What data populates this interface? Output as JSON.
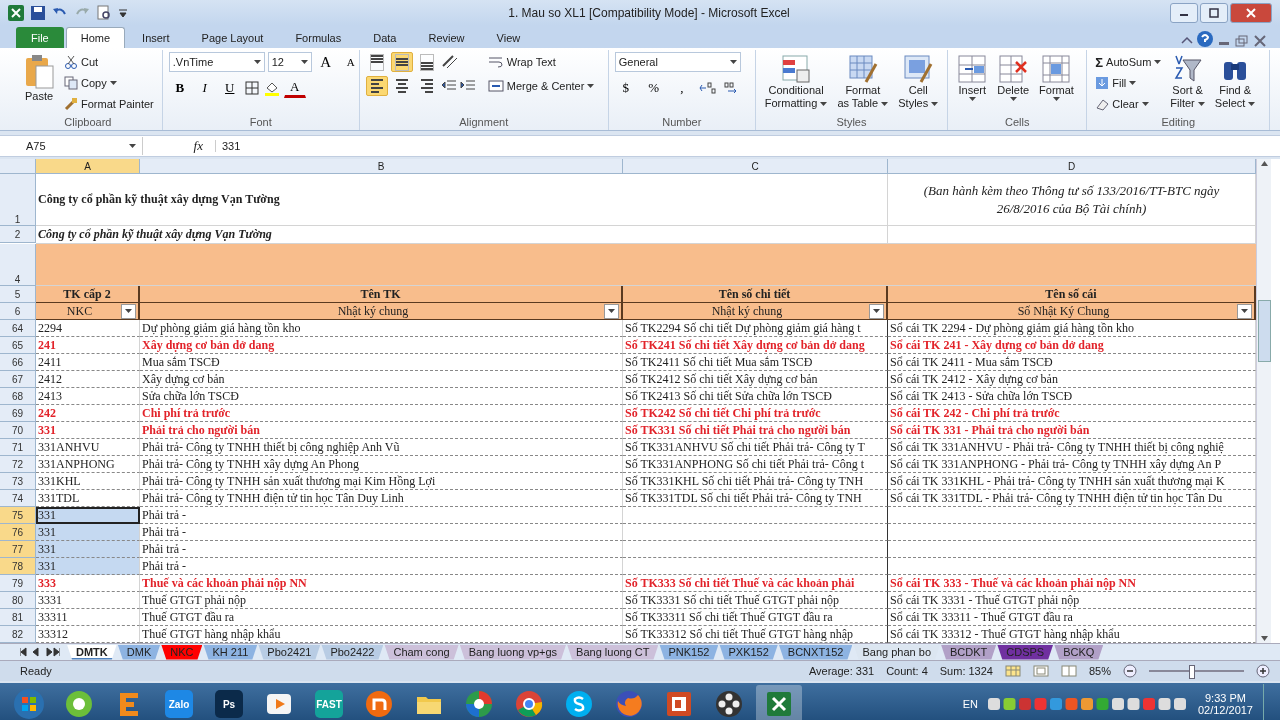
{
  "window": {
    "title": "1. Mau so XL1  [Compatibility Mode] - Microsoft Excel"
  },
  "ribbon_tabs": [
    {
      "label": "File",
      "kind": "file",
      "selected": false
    },
    {
      "label": "Home",
      "kind": "tab",
      "selected": true
    },
    {
      "label": "Insert",
      "kind": "tab",
      "selected": false
    },
    {
      "label": "Page Layout",
      "kind": "tab",
      "selected": false
    },
    {
      "label": "Formulas",
      "kind": "tab",
      "selected": false
    },
    {
      "label": "Data",
      "kind": "tab",
      "selected": false
    },
    {
      "label": "Review",
      "kind": "tab",
      "selected": false
    },
    {
      "label": "View",
      "kind": "tab",
      "selected": false
    }
  ],
  "clipboard": {
    "label": "Clipboard",
    "paste": "Paste",
    "cut": "Cut",
    "copy": "Copy",
    "format_painter": "Format Painter"
  },
  "font": {
    "label": "Font",
    "family": ".VnTime",
    "size": "12",
    "grow": "A",
    "shrink": "A",
    "styles": [
      "B",
      "I",
      "U"
    ],
    "font_color": "A"
  },
  "alignment": {
    "label": "Alignment",
    "wrap_text": "Wrap Text",
    "merge": "Merge & Center",
    "vertical": [
      {
        "kind": "top",
        "selected": false
      },
      {
        "kind": "middle",
        "selected": true
      },
      {
        "kind": "bottom",
        "selected": false
      }
    ],
    "horizontal": [
      {
        "kind": "left",
        "selected": true
      },
      {
        "kind": "center",
        "selected": false
      },
      {
        "kind": "right",
        "selected": false
      }
    ]
  },
  "number": {
    "label": "Number",
    "format": "General",
    "currency": "$",
    "percent": "%",
    "comma": ","
  },
  "styles": {
    "label": "Styles",
    "buttons": [
      {
        "kind": "conditional",
        "lines": [
          "Conditional",
          "Formatting"
        ]
      },
      {
        "kind": "table",
        "lines": [
          "Format",
          "as Table"
        ]
      },
      {
        "kind": "cellstyle",
        "lines": [
          "Cell",
          "Styles"
        ]
      }
    ]
  },
  "cells": {
    "label": "Cells",
    "buttons": [
      {
        "kind": "insert",
        "label": "Insert"
      },
      {
        "kind": "delete",
        "label": "Delete"
      },
      {
        "kind": "format",
        "label": "Format"
      }
    ]
  },
  "editing": {
    "label": "Editing",
    "sigma": "Σ",
    "autosum": "AutoSum",
    "fill": "Fill",
    "clear": "Clear",
    "sort": [
      "Sort &",
      "Filter"
    ],
    "find": [
      "Find &",
      "Select"
    ]
  },
  "formula_bar": {
    "name_box": "A75",
    "fx": "fx",
    "formula": "331"
  },
  "columns": [
    {
      "label": "A",
      "selected": true
    },
    {
      "label": "B",
      "selected": false
    },
    {
      "label": "C",
      "selected": false
    },
    {
      "label": "D",
      "selected": false
    }
  ],
  "title_rows": {
    "row1": {
      "number": "1",
      "company": "Công ty cổ phần kỹ thuật xây dựng Vạn Tường",
      "note": "(Ban hành kèm theo Thông tư số 133/2016/TT-BTC ngày 26/8/2016 của Bộ Tài chính)"
    },
    "row2": {
      "number": "2",
      "company": "Công ty cổ phần kỹ thuật xây dựng Vạn Tường"
    },
    "row4": {
      "number": "4"
    }
  },
  "header_rows": [
    {
      "number": "5",
      "cells": [
        "TK cấp 2",
        "Tên TK",
        "Tên số chi tiết",
        "Tên số cái"
      ]
    },
    {
      "number": "6",
      "cells": [
        "NKC",
        "Nhật ký chung",
        "Nhật ký chung",
        "Số Nhật Ký Chung"
      ]
    }
  ],
  "rows": [
    {
      "number": "64",
      "kind": "normal",
      "selected": false,
      "a": "2294",
      "b": "Dự phòng giảm giá hàng tồn kho",
      "c": "Số TK2294 Số chi tiết Dự phòng giảm giá hàng t",
      "d": "Sổ cái TK 2294 - Dự phòng giảm giá hàng tồn kho"
    },
    {
      "number": "65",
      "kind": "total",
      "selected": false,
      "a": "241",
      "b": "Xây dựng cơ bản dở dang",
      "c": "Số TK241 Số chi tiết Xây dựng cơ bản dở dang",
      "d": "Sổ cái TK 241 - Xây dựng cơ bản dở dang"
    },
    {
      "number": "66",
      "kind": "normal",
      "selected": false,
      "a": "2411",
      "b": "Mua sắm TSCĐ",
      "c": "Số TK2411 Số chi tiết Mua sắm TSCĐ",
      "d": "Sổ cái TK 2411 - Mua sắm TSCĐ"
    },
    {
      "number": "67",
      "kind": "normal",
      "selected": false,
      "a": "2412",
      "b": "Xây dựng cơ bản",
      "c": "Số TK2412 Số chi tiết Xây dựng cơ bản",
      "d": "Sổ cái TK 2412 - Xây dựng cơ bản"
    },
    {
      "number": "68",
      "kind": "normal",
      "selected": false,
      "a": "2413",
      "b": "Sửa chữa lớn TSCĐ",
      "c": "Số TK2413 Số chi tiết Sửa chữa lớn TSCĐ",
      "d": "Sổ cái TK 2413 - Sửa chữa lớn TSCĐ"
    },
    {
      "number": "69",
      "kind": "total",
      "selected": false,
      "a": "242",
      "b": "Chi phí trả trước",
      "c": "Số TK242 Số chi tiết Chi phí trả trước",
      "d": "Sổ cái TK 242 - Chi phí trả trước"
    },
    {
      "number": "70",
      "kind": "total",
      "selected": false,
      "a": "331",
      "b": "Phải trả cho người bán",
      "c": "Số TK331 Số chi tiết Phải trả cho người bán",
      "d": "Sổ cái TK 331 - Phải trả cho người bán"
    },
    {
      "number": "71",
      "kind": "normal",
      "selected": false,
      "a": "331ANHVU",
      "b": "Phải trả- Công ty TNHH thiết bị công nghiệp Anh Vũ",
      "c": "Số TK331ANHVU Số chi tiết Phải trả- Công ty T",
      "d": "Sổ cái TK 331ANHVU - Phải trả- Công ty TNHH thiết bị công nghiệ"
    },
    {
      "number": "72",
      "kind": "normal",
      "selected": false,
      "a": "331ANPHONG",
      "b": "Phải trả- Công ty TNHH xây dựng An Phong",
      "c": "Số TK331ANPHONG Số chi tiết Phải trả- Công t",
      "d": "Sổ cái TK 331ANPHONG - Phải trả- Công ty TNHH xây dựng An P"
    },
    {
      "number": "73",
      "kind": "normal",
      "selected": false,
      "a": "331KHL",
      "b": "Phải trả- Công ty TNHH sản xuất thương mại Kim Hồng Lợi",
      "c": "Số TK331KHL Số chi tiết Phải trả- Công ty TNH",
      "d": "Sổ cái TK 331KHL - Phải trả- Công ty TNHH sản xuất thương mại K"
    },
    {
      "number": "74",
      "kind": "normal",
      "selected": false,
      "a": "331TDL",
      "b": "Phải trả- Công ty TNHH điện tử tin học Tân Duy Linh",
      "c": "Số TK331TDL Số chi tiết Phải trả- Công ty TNH",
      "d": "Sổ cái TK 331TDL - Phải trả- Công ty TNHH điện tử tin học Tân Du"
    },
    {
      "number": "75",
      "kind": "normal",
      "selected": true,
      "a": "331",
      "b": "Phải trả -"
    },
    {
      "number": "76",
      "kind": "normal",
      "selected": true,
      "a": "331",
      "b": "Phải trả -"
    },
    {
      "number": "77",
      "kind": "normal",
      "selected": true,
      "a": "331",
      "b": "Phải trả -"
    },
    {
      "number": "78",
      "kind": "normal",
      "selected": true,
      "a": "331",
      "b": "Phải trả -"
    },
    {
      "number": "79",
      "kind": "total",
      "selected": false,
      "a": "333",
      "b": "Thuế và các khoản phải nộp NN",
      "c": "Số TK333 Số chi tiết Thuế và các khoản phải",
      "d": "Sổ cái TK 333 - Thuế và các khoản phải nộp NN"
    },
    {
      "number": "80",
      "kind": "normal",
      "selected": false,
      "a": "3331",
      "b": "Thuế GTGT phải nộp",
      "c": "Số TK3331 Số chi tiết Thuế GTGT phải nộp",
      "d": "Sổ cái TK 3331 - Thuế GTGT phải nộp"
    },
    {
      "number": "81",
      "kind": "normal",
      "selected": false,
      "a": "33311",
      "b": "Thuế GTGT đầu ra",
      "c": "Số TK33311 Số chi tiết Thuế GTGT đầu ra",
      "d": "Sổ cái TK 33311 - Thuế GTGT đầu ra"
    },
    {
      "number": "82",
      "kind": "normal",
      "selected": false,
      "a": "33312",
      "b": "Thuế GTGT hàng  nhập khẩu",
      "c": "Số TK33312 Số chi tiết Thuế GTGT hàng  nhập",
      "d": "Sổ cái TK 33312 - Thuế GTGT hàng  nhập khẩu"
    }
  ],
  "sheet_tabs": [
    {
      "label": "DMTK",
      "selected": true,
      "color": "#4f81bd"
    },
    {
      "label": "DMK",
      "selected": false,
      "color": "#8db3e2"
    },
    {
      "label": "NKC",
      "selected": false,
      "color": "#ff0000"
    },
    {
      "label": "KH 211",
      "selected": false,
      "color": "#8db3e2"
    },
    {
      "label": "Pbo2421",
      "selected": false,
      "color": "#b8cce4"
    },
    {
      "label": "Pbo2422",
      "selected": false,
      "color": "#b8cce4"
    },
    {
      "label": "Cham cong",
      "selected": false,
      "color": "#ccc0da"
    },
    {
      "label": "Bang luong vp+gs",
      "selected": false,
      "color": "#ccc0da"
    },
    {
      "label": "Bang luong CT",
      "selected": false,
      "color": "#ccc0da"
    },
    {
      "label": "PNK152",
      "selected": false,
      "color": "#8db3e2"
    },
    {
      "label": "PXK152",
      "selected": false,
      "color": "#8db3e2"
    },
    {
      "label": "BCNXT152",
      "selected": false,
      "color": "#8db3e2"
    },
    {
      "label": "Bang phan bo",
      "selected": false,
      "color": "#dce6f1"
    },
    {
      "label": "BCDKT",
      "selected": false,
      "color": "#b1a0c7"
    },
    {
      "label": "CDSPS",
      "selected": false,
      "color": "#7030a0"
    },
    {
      "label": "BCKQ",
      "selected": false,
      "color": "#b1a0c7"
    }
  ],
  "status_bar": {
    "mode": "Ready",
    "average": "Average: 331",
    "count": "Count: 4",
    "sum": "Sum: 1324",
    "zoom": "85%",
    "level": 0.45
  },
  "taskbar": {
    "apps": [
      {
        "kind": "start",
        "selected": false
      },
      {
        "kind": "green",
        "selected": false
      },
      {
        "kind": "orange-e",
        "selected": false
      },
      {
        "kind": "label",
        "label": "Zalo",
        "color": "#1e88e5",
        "selected": false
      },
      {
        "kind": "label",
        "label": "Ps",
        "color": "#0b2a4a",
        "selected": false
      },
      {
        "kind": "play",
        "selected": false
      },
      {
        "kind": "label",
        "label": "FAST",
        "color": "#14a39a",
        "selected": false
      },
      {
        "kind": "orange-circle",
        "selected": false
      },
      {
        "kind": "folder",
        "selected": false
      },
      {
        "kind": "pinwheel",
        "selected": false
      },
      {
        "kind": "chrome",
        "selected": false
      },
      {
        "kind": "skype",
        "selected": false
      },
      {
        "kind": "firefox",
        "selected": false
      },
      {
        "kind": "powerpoint",
        "selected": false
      },
      {
        "kind": "film",
        "selected": false
      },
      {
        "kind": "excel",
        "selected": true
      }
    ],
    "language": "EN",
    "time": "9:33 PM",
    "date": "02/12/2017"
  }
}
